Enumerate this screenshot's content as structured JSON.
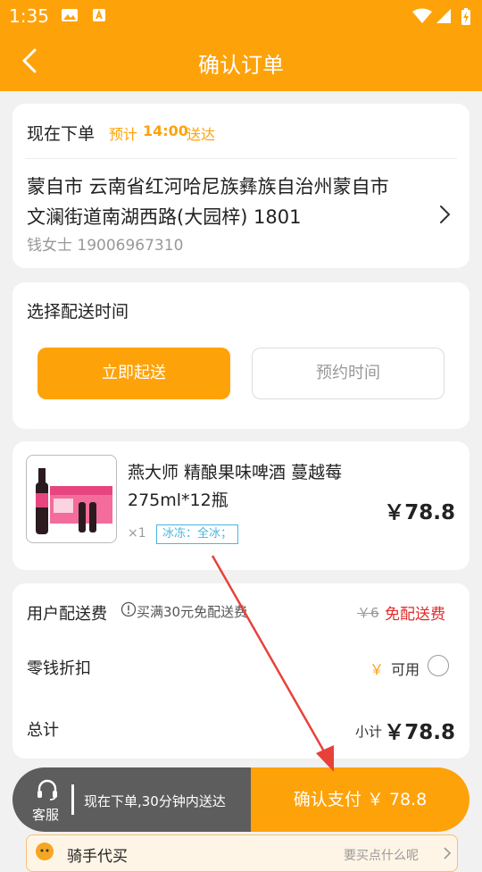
{
  "status_bar": {
    "time": "1:35"
  },
  "nav": {
    "title": "确认订单"
  },
  "address_card": {
    "order_now": "现在下单",
    "estimate_prefix": "预计",
    "estimate_time": "14:00",
    "estimate_suffix": "送达",
    "address_line1": "蒙自市 云南省红河哈尼族彝族自治州蒙自市",
    "address_line2": "文澜街道南湖西路(大园梓) 1801",
    "contact": "钱女士 19006967310"
  },
  "delivery_time": {
    "heading": "选择配送时间",
    "immediate_label": "立即起送",
    "schedule_label": "预约时间"
  },
  "product": {
    "name_line1": "燕大师 精酿果味啤酒 蔓越莓",
    "name_line2": "275ml*12瓶",
    "quantity": "×1",
    "tag": "冰冻：全冰；",
    "price": "￥78.8"
  },
  "summary": {
    "delivery_fee_label": "用户配送费",
    "free_note": "买满30元免配送费",
    "original_fee": "￥6",
    "free_label": "免配送费",
    "change_discount_label": "零钱折扣",
    "yen_symbol": "￥",
    "available_label": "可用",
    "total_label": "总计",
    "subtotal_label": "小计",
    "total_value": "￥78.8"
  },
  "bottom_bar": {
    "service_label": "客服",
    "promise": "现在下单,30分钟内送达",
    "confirm_pay": "确认支付 ￥ 78.8"
  },
  "rider_banner": {
    "label": "骑手代买",
    "hint": "要买点什么呢"
  },
  "colors": {
    "accent": "#fea20a",
    "price_red": "#e02d2d",
    "tag_blue": "#4bb6de",
    "dark_bar": "#5d5d5d"
  },
  "icons": {
    "back": "chevron-left-icon",
    "arrow": "chevron-right-icon",
    "headset": "headset-icon",
    "info": "info-icon",
    "radio": "radio-icon"
  }
}
